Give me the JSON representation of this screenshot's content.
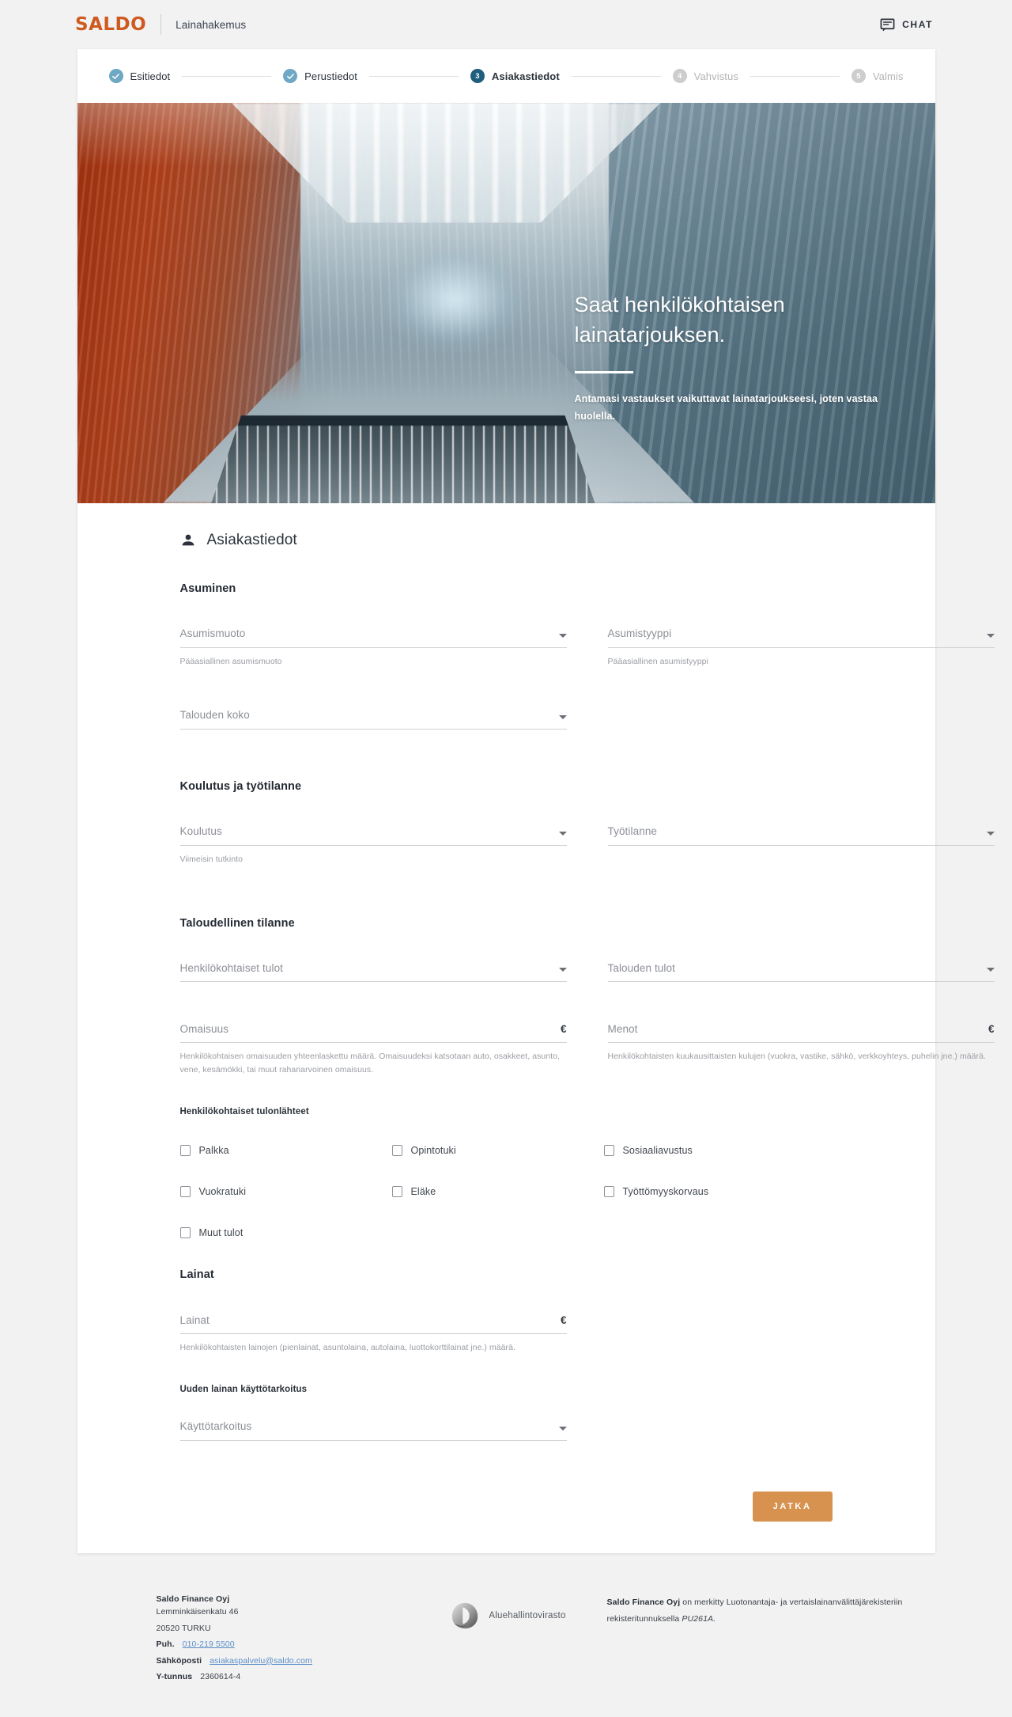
{
  "header": {
    "logo": "SALDO",
    "app_title": "Lainahakemus",
    "chat_label": "CHAT",
    "chat_icon": "chat-bubble-icon",
    "brand_color": "#cf5a20"
  },
  "stepper": {
    "steps": [
      {
        "label": "Esitiedot",
        "marker": "check",
        "state": "done"
      },
      {
        "label": "Perustiedot",
        "marker": "check",
        "state": "done"
      },
      {
        "label": "Asiakastiedot",
        "marker": "3",
        "state": "active"
      },
      {
        "label": "Vahvistus",
        "marker": "4",
        "state": "todo"
      },
      {
        "label": "Valmis",
        "marker": "5",
        "state": "todo"
      }
    ],
    "done_color": "#6fa8c4",
    "active_color": "#1f5f7e",
    "todo_color": "#cdcdcd"
  },
  "hero": {
    "title": "Saat henkilökohtaisen lainatarjouksen.",
    "subtitle": "Antamasi vastaukset vaikuttavat lainatarjoukseesi, joten vastaa huolella."
  },
  "form": {
    "icon": "person-icon",
    "title": "Asiakastiedot",
    "sections": [
      {
        "title": "Asuminen",
        "fields": [
          {
            "label": "Asumismuoto",
            "help": "Pääasiallinen asumismuoto",
            "type": "select"
          },
          {
            "label": "Asumistyyppi",
            "help": "Pääasiallinen asumistyyppi",
            "type": "select"
          },
          {
            "label": "Talouden koko",
            "help": "",
            "type": "select"
          }
        ]
      },
      {
        "title": "Koulutus ja työtilanne",
        "fields": [
          {
            "label": "Koulutus",
            "help": "Viimeisin tutkinto",
            "type": "select"
          },
          {
            "label": "Työtilanne",
            "help": "",
            "type": "select"
          }
        ]
      },
      {
        "title": "Taloudellinen tilanne",
        "fields": [
          {
            "label": "Henkilökohtaiset tulot",
            "help": "",
            "type": "select"
          },
          {
            "label": "Talouden tulot",
            "help": "",
            "type": "select"
          },
          {
            "label": "Omaisuus",
            "help": "Henkilökohtaisen omaisuuden yhteenlaskettu määrä. Omaisuudeksi katsotaan auto, osakkeet, asunto, vene, kesämökki, tai muut rahanarvoinen omaisuus.",
            "type": "currency",
            "suffix": "€"
          },
          {
            "label": "Menot",
            "help": "Henkilökohtaisten kuukausittaisten kulujen (vuokra, vastike, sähkö, verkkoyhteys, puhelin jne.) määrä.",
            "type": "currency",
            "suffix": "€"
          }
        ]
      }
    ],
    "income_sources": {
      "label": "Henkilökohtaiset tulonlähteet",
      "options": [
        {
          "label": "Palkka",
          "checked": false
        },
        {
          "label": "Opintotuki",
          "checked": false
        },
        {
          "label": "Sosiaaliavustus",
          "checked": false
        },
        {
          "label": "Vuokratuki",
          "checked": false
        },
        {
          "label": "Eläke",
          "checked": false
        },
        {
          "label": "Työttömyyskorvaus",
          "checked": false
        },
        {
          "label": "Muut tulot",
          "checked": false
        }
      ]
    },
    "loans": {
      "title": "Lainat",
      "amount": {
        "label": "Lainat",
        "suffix": "€",
        "help": "Henkilökohtaisten lainojen (pienlainat, asuntolaina, autolaina, luottokorttilainat jne.) määrä."
      },
      "purpose_label": "Uuden lainan käyttötarkoitus",
      "purpose_field": {
        "label": "Käyttötarkoitus",
        "type": "select"
      }
    },
    "submit_label": "JATKA",
    "submit_color": "#d79250"
  },
  "footer": {
    "company": "Saldo Finance Oyj",
    "street": "Lemminkäisenkatu 46",
    "city": "20520 TURKU",
    "phone_label": "Puh.",
    "phone": "010-219 5500",
    "email_label": "Sähköposti",
    "email": "asiakaspalvelu@saldo.com",
    "business_id_label": "Y-tunnus",
    "business_id": "2360614-4",
    "avi_name": "Aluehallintovirasto",
    "avi_icon": "avi-logo-icon",
    "note_strong": "Saldo Finance Oyj",
    "note_text": " on merkitty Luotonantaja- ja vertaislainanvälittäjärekisteriin rekisteritunnuksella ",
    "note_code": "PU261A."
  }
}
